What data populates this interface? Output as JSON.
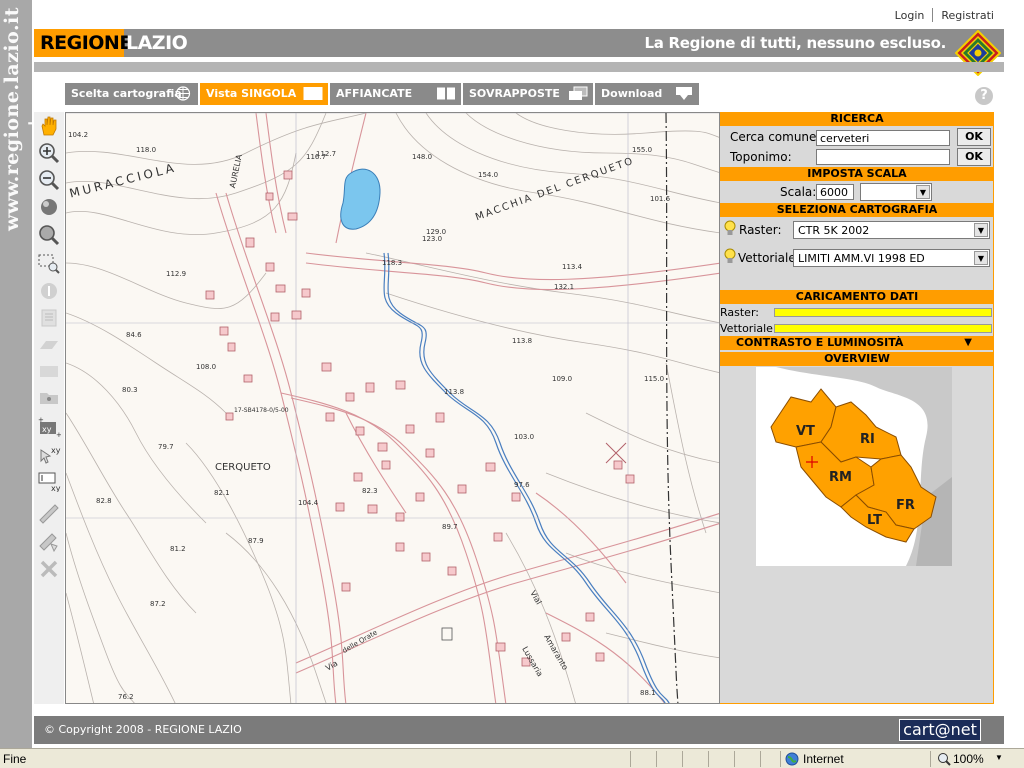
{
  "side_watermark": "www.regione.lazio.it +",
  "top_links": {
    "login": "Login",
    "register": "Registrati"
  },
  "header": {
    "logo_regione": "REGIONE",
    "logo_lazio": "LAZIO",
    "slogan": "La Regione di tutti, nessuno escluso."
  },
  "tabs": [
    {
      "label": "Scelta cartografia",
      "active": false
    },
    {
      "label": "Vista SINGOLA",
      "active": true
    },
    {
      "label": "AFFIANCATE",
      "active": false
    },
    {
      "label": "SOVRAPPOSTE",
      "active": false
    },
    {
      "label": "Download",
      "active": false
    }
  ],
  "help_label": "?",
  "toolbar": {
    "tools": [
      "pan-icon",
      "zoom-in-icon",
      "zoom-out-icon",
      "globe-icon",
      "zoom-full-icon",
      "zoom-box-icon",
      "info-icon",
      "layer-list-icon",
      "layer-icon",
      "print-icon",
      "folder-icon",
      "add-point-xy-icon",
      "goto-xy-icon",
      "input-xy-icon",
      "measure-distance-icon",
      "measure-area-icon",
      "clear-icon"
    ]
  },
  "map": {
    "place_labels": [
      "MURACCIOLA",
      "MACCHIA DEL CERQUETO",
      "CERQUETO",
      "AURELIA",
      "Via",
      "Lussaria",
      "Amaranto",
      "delle Orate",
      "Vial"
    ],
    "spot_heights": [
      "104.2",
      "118.0",
      "112.9",
      "84.6",
      "80.3",
      "79.7",
      "82.8",
      "81.2",
      "87.2",
      "76.2",
      "82.1",
      "87.9",
      "108.0",
      "148.0",
      "118.3",
      "154.0",
      "112.7",
      "155.0",
      "123.0",
      "113.8",
      "109.0",
      "115.0",
      "113.8",
      "97.6",
      "82.3",
      "103.0",
      "116.7",
      "129.0",
      "88.1",
      "113.4",
      "132.1",
      "101.6",
      "104.4",
      "89.7"
    ],
    "parcel_label": "17-SB4178-0/5-00"
  },
  "panel": {
    "ricerca_title": "RICERCA",
    "cerca_comune_label": "Cerca comune:",
    "cerca_comune_value": "cerveteri",
    "toponimo_label": "Toponimo:",
    "toponimo_value": "",
    "ok_label": "OK",
    "scala_title": "IMPOSTA SCALA",
    "scala_label": "Scala:",
    "scala_value": "6000",
    "cartografia_title": "SELEZIONA CARTOGRAFIA",
    "raster_label": "Raster:",
    "raster_value": "CTR  5K 2002",
    "vettoriale_label": "Vettoriale:",
    "vettoriale_value": "LIMITI AMM.VI 1998 ED",
    "caricamento_title": "CARICAMENTO DATI",
    "raster_load_label": "Raster:",
    "vettoriale_load_label": "Vettoriale:",
    "raster_load_progress": 1.0,
    "vettoriale_load_progress": 1.0,
    "contrasto_title": "CONTRASTO E LUMINOSITÀ",
    "overview_title": "OVERVIEW",
    "provinces": [
      "VT",
      "RI",
      "RM",
      "FR",
      "LT"
    ]
  },
  "footer": {
    "copyright": "© Copyright 2008 - REGIONE LAZIO",
    "brand": "cart@net"
  },
  "statusbar": {
    "status": "Fine",
    "zone": "Internet",
    "zoom": "100%"
  },
  "colors": {
    "accent": "#ff9d00",
    "header_gray": "#8d8d8d",
    "progress": "#ffff00",
    "footer_gray": "#7b7b7b"
  }
}
